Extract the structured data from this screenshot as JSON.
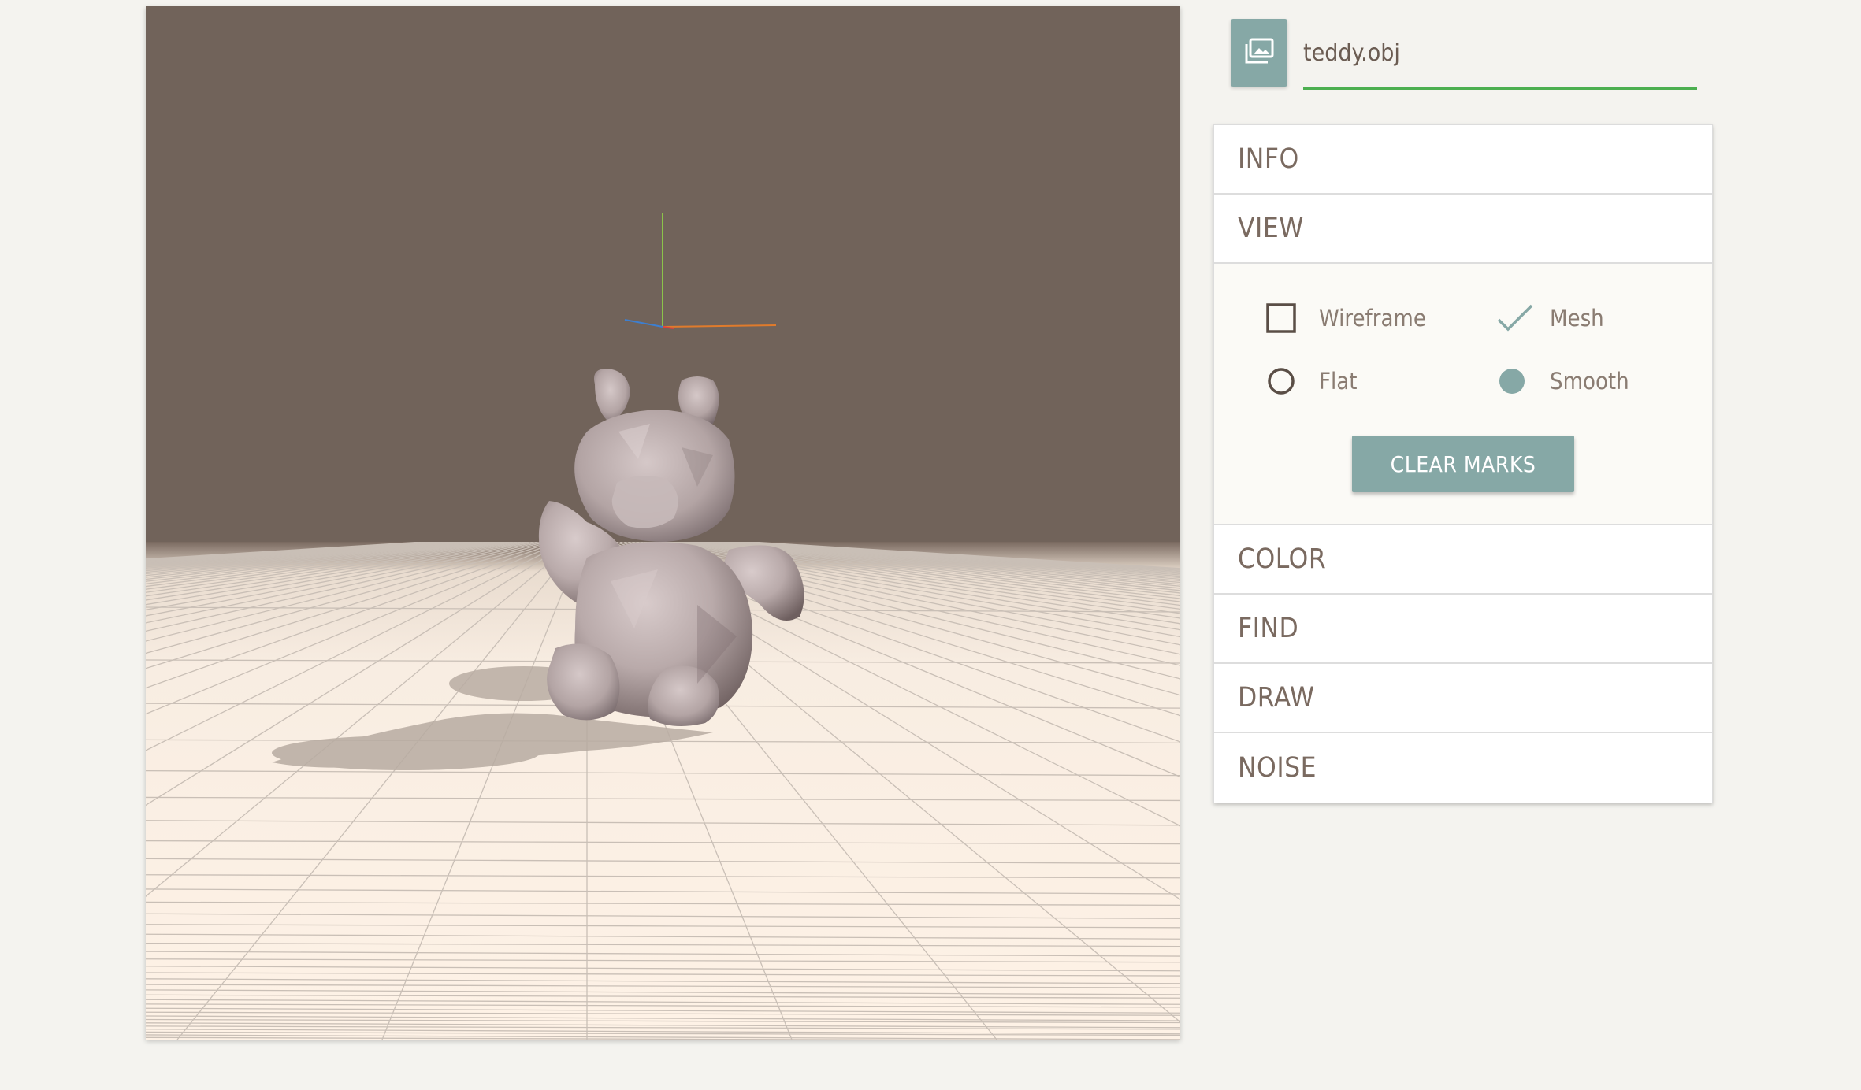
{
  "file": {
    "name": "teddy.obj",
    "icon": "photo-library-icon"
  },
  "colors": {
    "accent": "#86a8a6",
    "input_underline": "#4caf50",
    "text": "#7a6a60",
    "scene_background": "#71635a",
    "floor": "#fdf1e6"
  },
  "panel": {
    "sections": {
      "info": "INFO",
      "view": "VIEW",
      "color": "COLOR",
      "find": "FIND",
      "draw": "DRAW",
      "noise": "NOISE"
    },
    "view_options": {
      "wireframe": {
        "label": "Wireframe",
        "checked": false
      },
      "mesh": {
        "label": "Mesh",
        "checked": true
      },
      "flat": {
        "label": "Flat",
        "selected": false
      },
      "smooth": {
        "label": "Smooth",
        "selected": true
      },
      "clear_marks": "CLEAR MARKS"
    }
  }
}
